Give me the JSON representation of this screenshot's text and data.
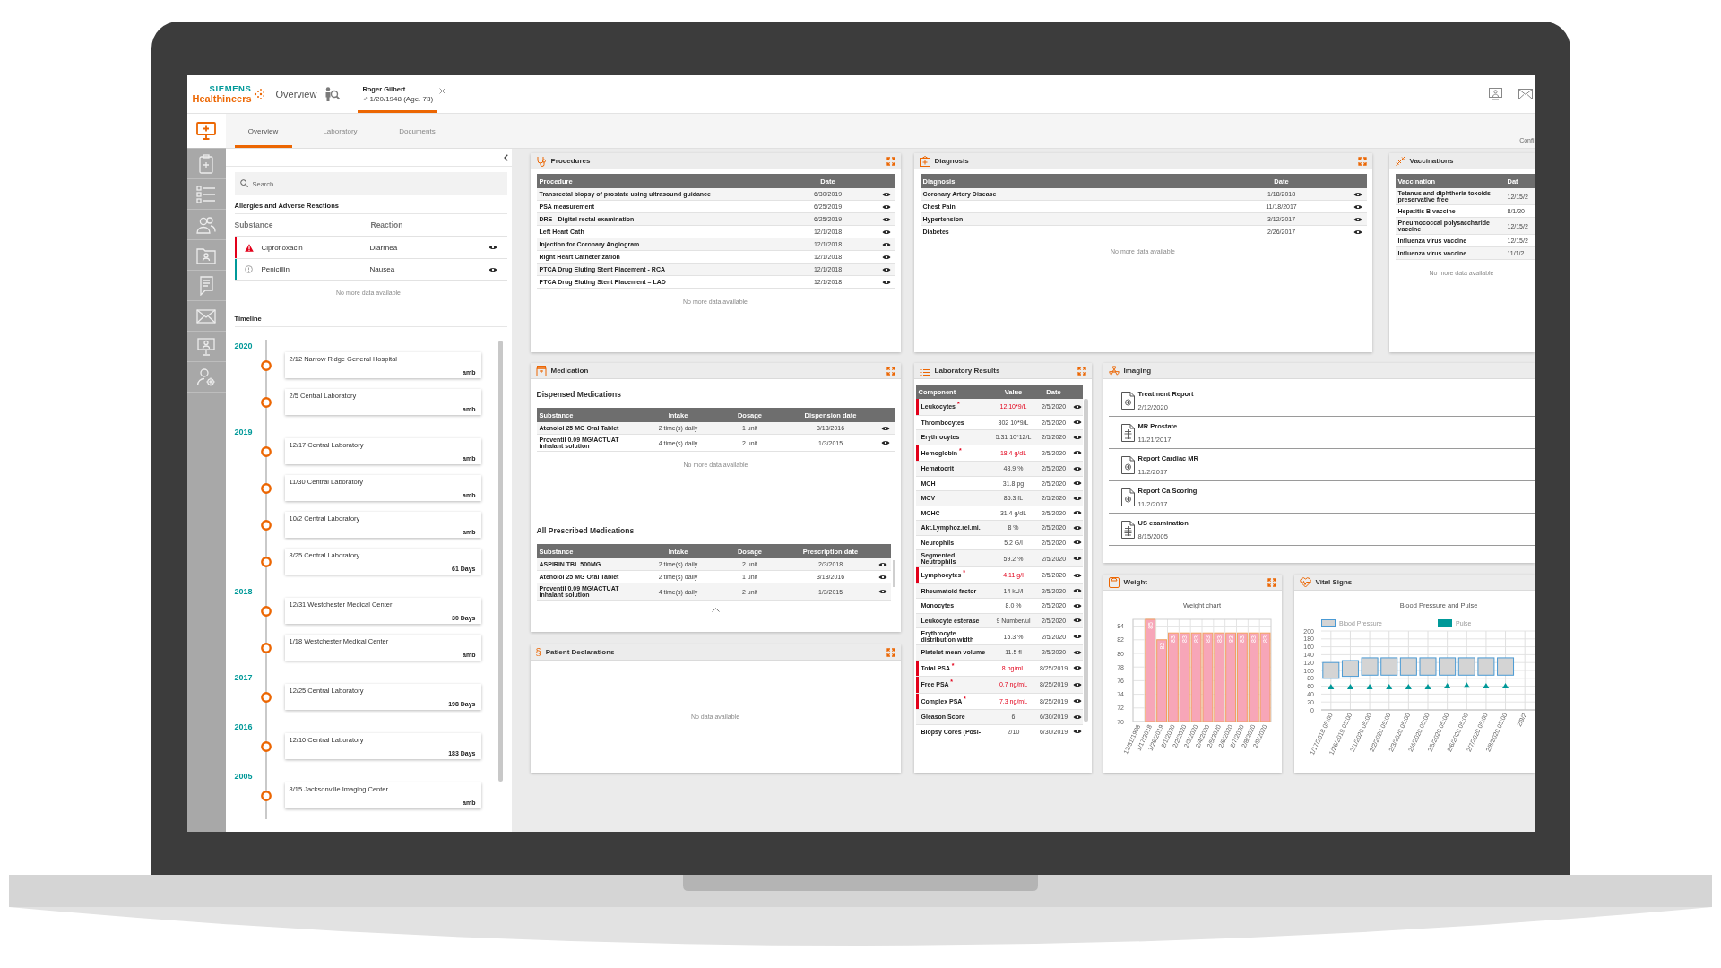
{
  "header": {
    "brand_top": "SIEMENS",
    "brand_bottom": "Healthineers",
    "nav_label": "Overview",
    "patient_tab": {
      "name": "Roger Gilbert",
      "sex_symbol": "♂",
      "details": "1/20/1948 (Age. 73)",
      "selected": true
    }
  },
  "rail": [
    {
      "selected": true
    },
    {
      "selected": false
    },
    {
      "selected": false
    },
    {
      "selected": false
    },
    {
      "selected": false
    },
    {
      "selected": false
    },
    {
      "selected": false
    },
    {
      "selected": false
    },
    {
      "selected": false
    }
  ],
  "tabs": [
    {
      "label": "Overview",
      "selected": true
    },
    {
      "label": "Laboratory",
      "selected": false
    },
    {
      "label": "Documents",
      "selected": false
    }
  ],
  "side_label": "Confi",
  "left_panel": {
    "search": {
      "placeholder": "Search"
    },
    "allergies": {
      "title": "Allergies and Adverse Reactions",
      "columns": [
        "Substance",
        "Reaction"
      ],
      "rows": [
        {
          "kind": "alert",
          "substance": "Ciprofloxacin",
          "reaction": "Diarrhea"
        },
        {
          "kind": "info",
          "substance": "Penicillin",
          "reaction": "Nausea"
        }
      ],
      "empty_note": "No more data available"
    },
    "timeline": {
      "title": "Timeline",
      "years": [
        {
          "year": "2020",
          "entries": [
            {
              "text": "2/12 Narrow Ridge General Hospital",
              "tag": "amb"
            },
            {
              "text": "2/5 Central Laboratory",
              "tag": "amb"
            }
          ]
        },
        {
          "year": "2019",
          "entries": [
            {
              "text": "12/17 Central Laboratory",
              "tag": "amb"
            },
            {
              "text": "11/30 Central Laboratory",
              "tag": "amb"
            },
            {
              "text": "10/2 Central Laboratory",
              "tag": "amb"
            },
            {
              "text": "8/25 Central Laboratory",
              "tag": "61 Days"
            }
          ]
        },
        {
          "year": "2018",
          "entries": [
            {
              "text": "12/31 Westchester Medical Center",
              "tag": "30 Days"
            },
            {
              "text": "1/18 Westchester Medical Center",
              "tag": "amb"
            }
          ]
        },
        {
          "year": "2017",
          "entries": [
            {
              "text": "12/25 Central Laboratory",
              "tag": "198 Days"
            }
          ]
        },
        {
          "year": "2016",
          "entries": [
            {
              "text": "12/10 Central Laboratory",
              "tag": "183 Days"
            }
          ]
        },
        {
          "year": "2005",
          "entries": [
            {
              "text": "8/15 Jacksonville Imaging Center",
              "tag": "amb"
            }
          ]
        }
      ]
    }
  },
  "procedures": {
    "title": "Procedures",
    "expand_button": true,
    "columns": [
      "Procedure",
      "Date"
    ],
    "rows": [
      {
        "name": "Transrectal biopsy of prostate using ultrasound guidance",
        "date": "6/30/2019"
      },
      {
        "name": "PSA measurement",
        "date": "6/25/2019"
      },
      {
        "name": "DRE - Digital rectal examination",
        "date": "6/25/2019"
      },
      {
        "name": "Left Heart Cath",
        "date": "12/1/2018"
      },
      {
        "name": "Injection for Coronary Angiogram",
        "date": "12/1/2018"
      },
      {
        "name": "Right Heart Catheterization",
        "date": "12/1/2018"
      },
      {
        "name": "PTCA Drug Eluting Stent Placement - RCA",
        "date": "12/1/2018"
      },
      {
        "name": "PTCA Drug Eluting Stent Placement – LAD",
        "date": "12/1/2018"
      }
    ],
    "empty_note": "No more data available"
  },
  "diagnosis": {
    "title": "Diagnosis",
    "expand_button": true,
    "columns": [
      "Diagnosis",
      "Date"
    ],
    "rows": [
      {
        "name": "Coronary Artery Disease",
        "date": "1/18/2018"
      },
      {
        "name": "Chest Pain",
        "date": "11/18/2017"
      },
      {
        "name": "Hypertension",
        "date": "3/12/2017"
      },
      {
        "name": "Diabetes",
        "date": "2/26/2017"
      }
    ],
    "empty_note": "No more data available"
  },
  "vaccinations": {
    "title": "Vaccinations",
    "columns": [
      "Vaccination",
      "Dat"
    ],
    "rows": [
      {
        "name": "Tetanus and diphtheria toxoids - preservative free",
        "date": "12/15/2"
      },
      {
        "name": "Hepatitis B vaccine",
        "date": "8/1/20"
      },
      {
        "name": "Pneumococcal polysaccharide vaccine",
        "date": "12/15/2"
      },
      {
        "name": "Influenza virus vaccine",
        "date": "12/15/2"
      },
      {
        "name": "Influenza virus vaccine",
        "date": "11/1/2"
      }
    ],
    "empty_note": "No more data available"
  },
  "medication": {
    "title": "Medication",
    "expand_button": true,
    "sections": [
      {
        "title": "Dispensed Medications",
        "columns": [
          "Substance",
          "Intake",
          "Dosage",
          "Dispension date"
        ],
        "rows": [
          {
            "substance": "Atenolol 25 MG Oral Tablet",
            "intake": "2 time(s) daily",
            "dosage": "1 unit",
            "date": "3/18/2016"
          },
          {
            "substance": "Proventil 0.09 MG/ACTUAT inhalant solution",
            "intake": "4 time(s) daily",
            "dosage": "2 unit",
            "date": "1/3/2015"
          }
        ],
        "empty_note": "No more data available"
      },
      {
        "title": "All Prescribed Medications",
        "columns": [
          "Substance",
          "Intake",
          "Dosage",
          "Prescription date"
        ],
        "rows": [
          {
            "substance": "ASPIRIN TBL 500MG",
            "intake": "2 time(s) daily",
            "dosage": "2 unit",
            "date": "2/3/2018"
          },
          {
            "substance": "Atenolol 25 MG Oral Tablet",
            "intake": "2 time(s) daily",
            "dosage": "1 unit",
            "date": "3/18/2016"
          },
          {
            "substance": "Proventil 0.09 MG/ACTUAT inhalant solution",
            "intake": "4 time(s) daily",
            "dosage": "2 unit",
            "date": "1/3/2015"
          }
        ]
      }
    ]
  },
  "patient_declarations": {
    "title": "Patient Declarations",
    "icon": "§",
    "expand_button": true,
    "empty_note": "No data available"
  },
  "lab_results": {
    "title": "Laboratory Results",
    "expand_button": true,
    "columns": [
      "Component",
      "Value",
      "Date"
    ],
    "rows": [
      {
        "component": "Leukocytes $^{*}$",
        "abnormal": true,
        "value": "12.10*9/L",
        "date": "2/5/2020"
      },
      {
        "component": "Thrombocytes",
        "abnormal": false,
        "value": "302 10*9/L",
        "date": "2/5/2020"
      },
      {
        "component": "Erythrocytes",
        "abnormal": false,
        "value": "5.31 10*12/L",
        "date": "2/5/2020"
      },
      {
        "component": "Hemoglobin $^{*}$",
        "abnormal": true,
        "value": "18.4 g/dL",
        "date": "2/5/2020"
      },
      {
        "component": "Hematocrit",
        "abnormal": false,
        "value": "48.9 %",
        "date": "2/5/2020"
      },
      {
        "component": "MCH",
        "abnormal": false,
        "value": "31.8 pg",
        "date": "2/5/2020"
      },
      {
        "component": "MCV",
        "abnormal": false,
        "value": "85.3 fL",
        "date": "2/5/2020"
      },
      {
        "component": "MCHC",
        "abnormal": false,
        "value": "31.4 g/dL",
        "date": "2/5/2020"
      },
      {
        "component": "Akt.Lymphoz.rel.mi.",
        "abnormal": false,
        "value": "8 %",
        "date": "2/5/2020"
      },
      {
        "component": "Neurophils",
        "abnormal": false,
        "value": "5.2 G/l",
        "date": "2/5/2020"
      },
      {
        "component": "Segmented Neutrophils",
        "abnormal": false,
        "value": "59.2 %",
        "date": "2/5/2020"
      },
      {
        "component": "Lymphocytes $^{*}$",
        "abnormal": true,
        "value": "4.11 g/l",
        "date": "2/5/2020"
      },
      {
        "component": "Rheumatoid factor",
        "abnormal": false,
        "value": "14 kU/l",
        "date": "2/5/2020"
      },
      {
        "component": "Monocytes",
        "abnormal": false,
        "value": "8.0 %",
        "date": "2/5/2020"
      },
      {
        "component": "Leukocyte esterase",
        "abnormal": false,
        "value": "9 Number/ul",
        "date": "2/5/2020"
      },
      {
        "component": "Erythrocyte distribution width",
        "abnormal": false,
        "value": "15.3 %",
        "date": "2/5/2020"
      },
      {
        "component": "Platelet mean volume",
        "abnormal": false,
        "value": "11.5 fl",
        "date": "2/5/2020"
      },
      {
        "component": "Total PSA $^{*}$",
        "abnormal": true,
        "value": "8 ng/mL",
        "date": "8/25/2019"
      },
      {
        "component": "Free PSA $^{*}$",
        "abnormal": true,
        "value": "0.7 ng/mL",
        "date": "8/25/2019"
      },
      {
        "component": "Complex PSA $^{*}$",
        "abnormal": true,
        "value": "7.3 ng/mL",
        "date": "8/25/2019"
      },
      {
        "component": "Gleason Score",
        "abnormal": false,
        "value": "6",
        "date": "6/30/2019"
      },
      {
        "component": "Biopsy Cores (Posi-",
        "abnormal": false,
        "value": "2/10",
        "date": "6/30/2019"
      }
    ]
  },
  "imaging": {
    "title": "Imaging",
    "items": [
      {
        "kind": "report",
        "title": "Treatment Report",
        "date": "2/12/2020"
      },
      {
        "kind": "scan",
        "title": "MR Prostate",
        "date": "11/21/2017"
      },
      {
        "kind": "report",
        "title": "Report Cardiac MR",
        "date": "11/2/2017"
      },
      {
        "kind": "report",
        "title": "Report Ca Scoring",
        "date": "11/2/2017"
      },
      {
        "kind": "scan",
        "title": "US examination",
        "date": "8/15/2005"
      }
    ]
  },
  "weight": {
    "title": "Weight",
    "expand_button": true,
    "chart_data": {
      "type": "bar",
      "title": "Weight chart",
      "categories": [
        "12/31/1998",
        "1/17/2018",
        "1/26/2019",
        "2/1/2020",
        "2/2/2020",
        "2/3/2020",
        "2/4/2020",
        "2/5/2020",
        "2/6/2020",
        "2/7/2020",
        "2/8/2020",
        "2/9/2020"
      ],
      "values": [
        null,
        85,
        82,
        83,
        83,
        83,
        83,
        83,
        83,
        83,
        83,
        83
      ],
      "ylim": [
        70,
        85
      ],
      "yticks": [
        70,
        72,
        74,
        76,
        78,
        80,
        82,
        84
      ],
      "data_labels": true,
      "grid": true
    }
  },
  "vital_signs": {
    "title": "Vital Signs",
    "chart_data": {
      "type": "candlestick",
      "title": "Blood Pressure and Pulse",
      "legend": "top",
      "categories": [
        "1/17/2018 05:00",
        "1/26/2019 05:00",
        "2/1/2020 05:00",
        "2/2/2020 05:00",
        "2/3/2020 05:00",
        "2/4/2020 05:00",
        "2/5/2020 05:00",
        "2/6/2020 05:00",
        "2/7/2020 05:00",
        "2/8/2020 05:00",
        "2/9/2"
      ],
      "series": [
        {
          "name": "Blood Pressure",
          "color": "#d4d4d4",
          "ohlc": [
            [
              80,
              120,
              80,
              120
            ],
            [
              85,
              125,
              85,
              125
            ],
            [
              88,
              132,
              88,
              132
            ],
            [
              88,
              132,
              88,
              132
            ],
            [
              88,
              132,
              88,
              132
            ],
            [
              88,
              132,
              88,
              132
            ],
            [
              88,
              132,
              88,
              132
            ],
            [
              88,
              132,
              88,
              132
            ],
            [
              88,
              132,
              88,
              132
            ],
            [
              88,
              132,
              88,
              132
            ],
            null
          ]
        },
        {
          "name": "Pulse",
          "type": "scatter",
          "color": "#009999",
          "values": [
            58,
            58,
            58,
            58,
            58,
            58,
            60,
            62,
            60,
            60,
            null
          ]
        }
      ],
      "ylim": [
        0,
        200
      ],
      "yticks": [
        0,
        20,
        40,
        60,
        80,
        100,
        120,
        140,
        160,
        180,
        200
      ],
      "grid": true
    }
  }
}
